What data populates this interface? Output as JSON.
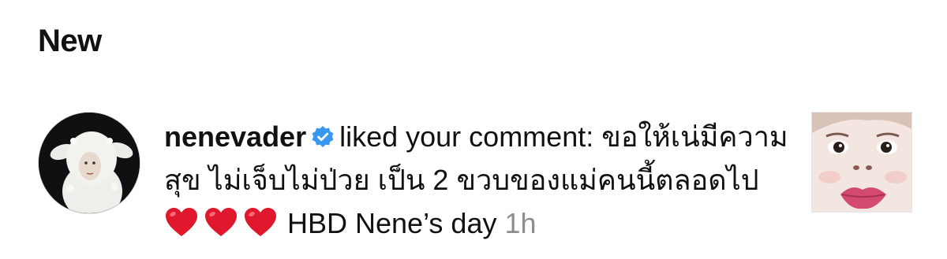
{
  "section": {
    "title": "New"
  },
  "notification": {
    "username": "nenevader",
    "verified": true,
    "action": "liked your comment:",
    "comment_text": "ขอให้เน่มีความสุข ไม่เจ็บไม่ป่วย เป็น 2 ขวบของแม่คนนี้ตลอดไป",
    "hearts": [
      "❤️",
      "❤️",
      "❤️"
    ],
    "comment_suffix": "HBD Nene’s day",
    "time": "1h",
    "avatar_icon": "sheep-costume-avatar-icon",
    "thumbnail_icon": "post-thumbnail-face-icon"
  },
  "colors": {
    "verified_badge": "#3897f0",
    "timestamp": "#8e8e8e",
    "heart": "#e0182d"
  }
}
